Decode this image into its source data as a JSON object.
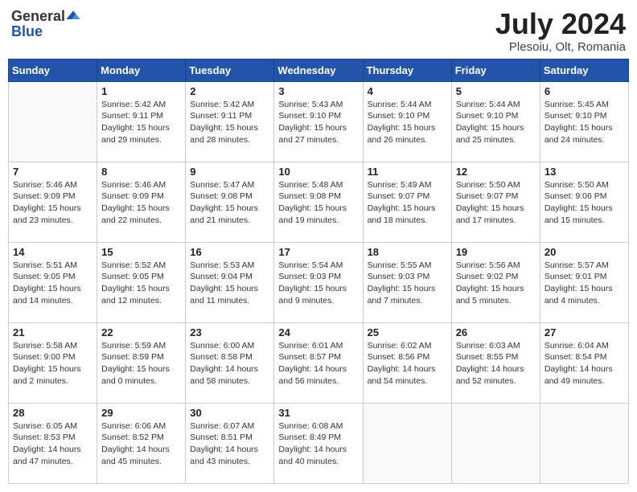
{
  "header": {
    "logo_general": "General",
    "logo_blue": "Blue",
    "title": "July 2024",
    "subtitle": "Plesoiu, Olt, Romania"
  },
  "days_of_week": [
    "Sunday",
    "Monday",
    "Tuesday",
    "Wednesday",
    "Thursday",
    "Friday",
    "Saturday"
  ],
  "weeks": [
    [
      {
        "day": "",
        "info": ""
      },
      {
        "day": "1",
        "info": "Sunrise: 5:42 AM\nSunset: 9:11 PM\nDaylight: 15 hours\nand 29 minutes."
      },
      {
        "day": "2",
        "info": "Sunrise: 5:42 AM\nSunset: 9:11 PM\nDaylight: 15 hours\nand 28 minutes."
      },
      {
        "day": "3",
        "info": "Sunrise: 5:43 AM\nSunset: 9:10 PM\nDaylight: 15 hours\nand 27 minutes."
      },
      {
        "day": "4",
        "info": "Sunrise: 5:44 AM\nSunset: 9:10 PM\nDaylight: 15 hours\nand 26 minutes."
      },
      {
        "day": "5",
        "info": "Sunrise: 5:44 AM\nSunset: 9:10 PM\nDaylight: 15 hours\nand 25 minutes."
      },
      {
        "day": "6",
        "info": "Sunrise: 5:45 AM\nSunset: 9:10 PM\nDaylight: 15 hours\nand 24 minutes."
      }
    ],
    [
      {
        "day": "7",
        "info": "Sunrise: 5:46 AM\nSunset: 9:09 PM\nDaylight: 15 hours\nand 23 minutes."
      },
      {
        "day": "8",
        "info": "Sunrise: 5:46 AM\nSunset: 9:09 PM\nDaylight: 15 hours\nand 22 minutes."
      },
      {
        "day": "9",
        "info": "Sunrise: 5:47 AM\nSunset: 9:08 PM\nDaylight: 15 hours\nand 21 minutes."
      },
      {
        "day": "10",
        "info": "Sunrise: 5:48 AM\nSunset: 9:08 PM\nDaylight: 15 hours\nand 19 minutes."
      },
      {
        "day": "11",
        "info": "Sunrise: 5:49 AM\nSunset: 9:07 PM\nDaylight: 15 hours\nand 18 minutes."
      },
      {
        "day": "12",
        "info": "Sunrise: 5:50 AM\nSunset: 9:07 PM\nDaylight: 15 hours\nand 17 minutes."
      },
      {
        "day": "13",
        "info": "Sunrise: 5:50 AM\nSunset: 9:06 PM\nDaylight: 15 hours\nand 15 minutes."
      }
    ],
    [
      {
        "day": "14",
        "info": "Sunrise: 5:51 AM\nSunset: 9:05 PM\nDaylight: 15 hours\nand 14 minutes."
      },
      {
        "day": "15",
        "info": "Sunrise: 5:52 AM\nSunset: 9:05 PM\nDaylight: 15 hours\nand 12 minutes."
      },
      {
        "day": "16",
        "info": "Sunrise: 5:53 AM\nSunset: 9:04 PM\nDaylight: 15 hours\nand 11 minutes."
      },
      {
        "day": "17",
        "info": "Sunrise: 5:54 AM\nSunset: 9:03 PM\nDaylight: 15 hours\nand 9 minutes."
      },
      {
        "day": "18",
        "info": "Sunrise: 5:55 AM\nSunset: 9:03 PM\nDaylight: 15 hours\nand 7 minutes."
      },
      {
        "day": "19",
        "info": "Sunrise: 5:56 AM\nSunset: 9:02 PM\nDaylight: 15 hours\nand 5 minutes."
      },
      {
        "day": "20",
        "info": "Sunrise: 5:57 AM\nSunset: 9:01 PM\nDaylight: 15 hours\nand 4 minutes."
      }
    ],
    [
      {
        "day": "21",
        "info": "Sunrise: 5:58 AM\nSunset: 9:00 PM\nDaylight: 15 hours\nand 2 minutes."
      },
      {
        "day": "22",
        "info": "Sunrise: 5:59 AM\nSunset: 8:59 PM\nDaylight: 15 hours\nand 0 minutes."
      },
      {
        "day": "23",
        "info": "Sunrise: 6:00 AM\nSunset: 8:58 PM\nDaylight: 14 hours\nand 58 minutes."
      },
      {
        "day": "24",
        "info": "Sunrise: 6:01 AM\nSunset: 8:57 PM\nDaylight: 14 hours\nand 56 minutes."
      },
      {
        "day": "25",
        "info": "Sunrise: 6:02 AM\nSunset: 8:56 PM\nDaylight: 14 hours\nand 54 minutes."
      },
      {
        "day": "26",
        "info": "Sunrise: 6:03 AM\nSunset: 8:55 PM\nDaylight: 14 hours\nand 52 minutes."
      },
      {
        "day": "27",
        "info": "Sunrise: 6:04 AM\nSunset: 8:54 PM\nDaylight: 14 hours\nand 49 minutes."
      }
    ],
    [
      {
        "day": "28",
        "info": "Sunrise: 6:05 AM\nSunset: 8:53 PM\nDaylight: 14 hours\nand 47 minutes."
      },
      {
        "day": "29",
        "info": "Sunrise: 6:06 AM\nSunset: 8:52 PM\nDaylight: 14 hours\nand 45 minutes."
      },
      {
        "day": "30",
        "info": "Sunrise: 6:07 AM\nSunset: 8:51 PM\nDaylight: 14 hours\nand 43 minutes."
      },
      {
        "day": "31",
        "info": "Sunrise: 6:08 AM\nSunset: 8:49 PM\nDaylight: 14 hours\nand 40 minutes."
      },
      {
        "day": "",
        "info": ""
      },
      {
        "day": "",
        "info": ""
      },
      {
        "day": "",
        "info": ""
      }
    ]
  ]
}
